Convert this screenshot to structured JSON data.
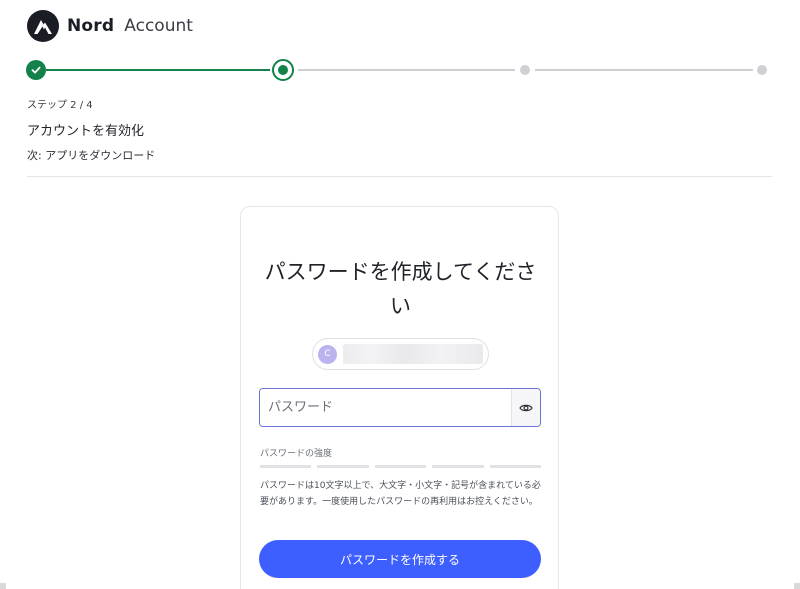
{
  "header": {
    "brand": "Nord",
    "brand_sub": "Account",
    "logo_icon": "nord-mountain-logo"
  },
  "stepper": {
    "total": 4,
    "current": 2,
    "colors": {
      "done": "#13824a",
      "pending": "#cfd0d4"
    }
  },
  "step_info": {
    "count": "ステップ 2 / 4",
    "title": "アカウントを有効化",
    "next": "次: アプリをダウンロード"
  },
  "card": {
    "title": "パスワードを作成してください",
    "email_avatar_letter": "C",
    "password_placeholder": "パスワード",
    "eye_icon": "eye-icon",
    "strength_label": "パスワードの強度",
    "strength_segments": 5,
    "help_text": "パスワードは10文字以上で、大文字・小文字・記号が含まれている必要があります。一度使用したパスワードの再利用はお控えください。",
    "submit_label": "パスワードを作成する",
    "accent": "#3e5fff"
  }
}
